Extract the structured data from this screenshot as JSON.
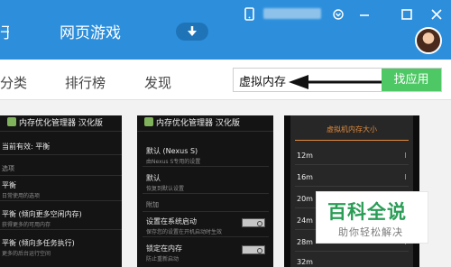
{
  "header": {
    "nav_partial": "于",
    "nav_web_games": "网页游戏"
  },
  "tabs": {
    "category_partial": "分类",
    "rankings": "排行榜",
    "discover": "发现"
  },
  "search": {
    "value": "虚拟内存",
    "button_label": "找应用"
  },
  "screenshot1": {
    "header": "内存优化管理器 汉化版",
    "current_effective": "当前有效: 平衡",
    "options_section": "选项",
    "items": [
      {
        "title": "平衡",
        "desc": "日常使用的选项"
      },
      {
        "title": "平衡 (倾向更多空闲内存)",
        "desc": "获得更多的可用内存"
      },
      {
        "title": "平衡 (倾向多任务执行)",
        "desc": "更多的后台运行空间"
      }
    ]
  },
  "screenshot2": {
    "header": "内存优化管理器 汉化版",
    "items": [
      {
        "title": "默认 (Nexus S)",
        "desc": "由Nexus S专用的设置"
      },
      {
        "title": "默认",
        "desc": "恢复到默认设置"
      }
    ],
    "extra_section": "附加",
    "toggles": [
      {
        "title": "设置在系统启动",
        "desc": "保存您的设置在开机启动时生效"
      },
      {
        "title": "锁定在内存",
        "desc": "防止重新启动"
      }
    ]
  },
  "screenshot3": {
    "title": "虚拟机内存大小",
    "sizes": [
      "12m",
      "16m",
      "20m",
      "24m",
      "28m",
      "32m"
    ]
  },
  "watermark": {
    "title": "百科全说",
    "subtitle": "助你轻松解决"
  },
  "colors": {
    "titlebar": "#2d8fdc",
    "search_button": "#4ec865",
    "accent_orange": "#e08a3c",
    "watermark_green": "#2a9d56"
  }
}
